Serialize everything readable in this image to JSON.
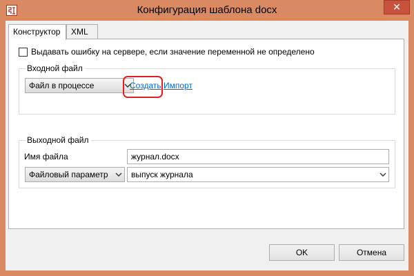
{
  "window": {
    "title": "Конфигурация шаблона docx",
    "close_label": "✕"
  },
  "tabs": [
    {
      "label": "Конструктор"
    },
    {
      "label": "XML"
    }
  ],
  "options": {
    "error_on_undefined_label": "Выдавать ошибку на сервере, если значение переменной не определено"
  },
  "input_file": {
    "group_label": "Входной файл",
    "source_selected": "Файл в процессе",
    "create_link": "Создать",
    "import_link": "Импорт"
  },
  "output_file": {
    "group_label": "Выходной файл",
    "filename_label": "Имя файла",
    "filename_value": "журнал.docx",
    "param_type_selected": "Файловый параметр",
    "param_value_selected": "выпуск журнала"
  },
  "footer": {
    "ok_label": "OK",
    "cancel_label": "Отмена"
  }
}
